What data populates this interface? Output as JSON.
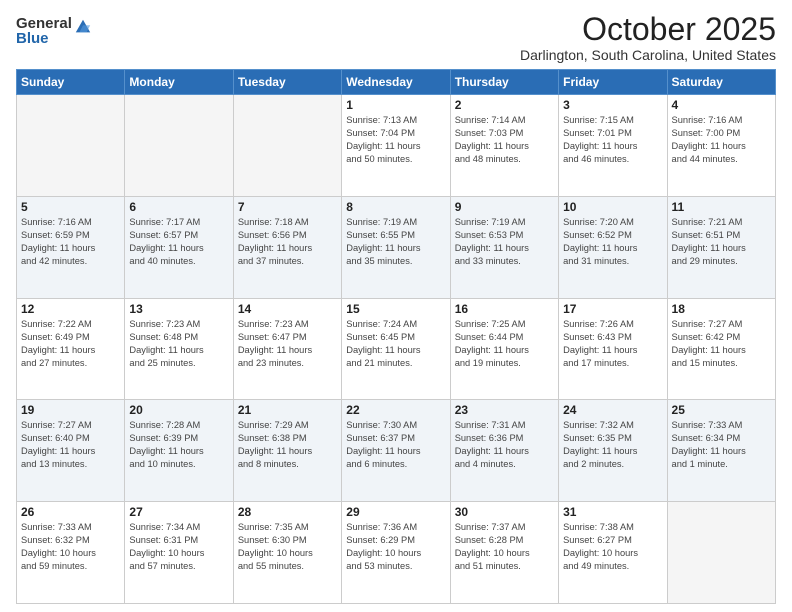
{
  "logo": {
    "general": "General",
    "blue": "Blue"
  },
  "header": {
    "month": "October 2025",
    "location": "Darlington, South Carolina, United States"
  },
  "days_of_week": [
    "Sunday",
    "Monday",
    "Tuesday",
    "Wednesday",
    "Thursday",
    "Friday",
    "Saturday"
  ],
  "weeks": [
    [
      {
        "day": "",
        "info": ""
      },
      {
        "day": "",
        "info": ""
      },
      {
        "day": "",
        "info": ""
      },
      {
        "day": "1",
        "info": "Sunrise: 7:13 AM\nSunset: 7:04 PM\nDaylight: 11 hours\nand 50 minutes."
      },
      {
        "day": "2",
        "info": "Sunrise: 7:14 AM\nSunset: 7:03 PM\nDaylight: 11 hours\nand 48 minutes."
      },
      {
        "day": "3",
        "info": "Sunrise: 7:15 AM\nSunset: 7:01 PM\nDaylight: 11 hours\nand 46 minutes."
      },
      {
        "day": "4",
        "info": "Sunrise: 7:16 AM\nSunset: 7:00 PM\nDaylight: 11 hours\nand 44 minutes."
      }
    ],
    [
      {
        "day": "5",
        "info": "Sunrise: 7:16 AM\nSunset: 6:59 PM\nDaylight: 11 hours\nand 42 minutes."
      },
      {
        "day": "6",
        "info": "Sunrise: 7:17 AM\nSunset: 6:57 PM\nDaylight: 11 hours\nand 40 minutes."
      },
      {
        "day": "7",
        "info": "Sunrise: 7:18 AM\nSunset: 6:56 PM\nDaylight: 11 hours\nand 37 minutes."
      },
      {
        "day": "8",
        "info": "Sunrise: 7:19 AM\nSunset: 6:55 PM\nDaylight: 11 hours\nand 35 minutes."
      },
      {
        "day": "9",
        "info": "Sunrise: 7:19 AM\nSunset: 6:53 PM\nDaylight: 11 hours\nand 33 minutes."
      },
      {
        "day": "10",
        "info": "Sunrise: 7:20 AM\nSunset: 6:52 PM\nDaylight: 11 hours\nand 31 minutes."
      },
      {
        "day": "11",
        "info": "Sunrise: 7:21 AM\nSunset: 6:51 PM\nDaylight: 11 hours\nand 29 minutes."
      }
    ],
    [
      {
        "day": "12",
        "info": "Sunrise: 7:22 AM\nSunset: 6:49 PM\nDaylight: 11 hours\nand 27 minutes."
      },
      {
        "day": "13",
        "info": "Sunrise: 7:23 AM\nSunset: 6:48 PM\nDaylight: 11 hours\nand 25 minutes."
      },
      {
        "day": "14",
        "info": "Sunrise: 7:23 AM\nSunset: 6:47 PM\nDaylight: 11 hours\nand 23 minutes."
      },
      {
        "day": "15",
        "info": "Sunrise: 7:24 AM\nSunset: 6:45 PM\nDaylight: 11 hours\nand 21 minutes."
      },
      {
        "day": "16",
        "info": "Sunrise: 7:25 AM\nSunset: 6:44 PM\nDaylight: 11 hours\nand 19 minutes."
      },
      {
        "day": "17",
        "info": "Sunrise: 7:26 AM\nSunset: 6:43 PM\nDaylight: 11 hours\nand 17 minutes."
      },
      {
        "day": "18",
        "info": "Sunrise: 7:27 AM\nSunset: 6:42 PM\nDaylight: 11 hours\nand 15 minutes."
      }
    ],
    [
      {
        "day": "19",
        "info": "Sunrise: 7:27 AM\nSunset: 6:40 PM\nDaylight: 11 hours\nand 13 minutes."
      },
      {
        "day": "20",
        "info": "Sunrise: 7:28 AM\nSunset: 6:39 PM\nDaylight: 11 hours\nand 10 minutes."
      },
      {
        "day": "21",
        "info": "Sunrise: 7:29 AM\nSunset: 6:38 PM\nDaylight: 11 hours\nand 8 minutes."
      },
      {
        "day": "22",
        "info": "Sunrise: 7:30 AM\nSunset: 6:37 PM\nDaylight: 11 hours\nand 6 minutes."
      },
      {
        "day": "23",
        "info": "Sunrise: 7:31 AM\nSunset: 6:36 PM\nDaylight: 11 hours\nand 4 minutes."
      },
      {
        "day": "24",
        "info": "Sunrise: 7:32 AM\nSunset: 6:35 PM\nDaylight: 11 hours\nand 2 minutes."
      },
      {
        "day": "25",
        "info": "Sunrise: 7:33 AM\nSunset: 6:34 PM\nDaylight: 11 hours\nand 1 minute."
      }
    ],
    [
      {
        "day": "26",
        "info": "Sunrise: 7:33 AM\nSunset: 6:32 PM\nDaylight: 10 hours\nand 59 minutes."
      },
      {
        "day": "27",
        "info": "Sunrise: 7:34 AM\nSunset: 6:31 PM\nDaylight: 10 hours\nand 57 minutes."
      },
      {
        "day": "28",
        "info": "Sunrise: 7:35 AM\nSunset: 6:30 PM\nDaylight: 10 hours\nand 55 minutes."
      },
      {
        "day": "29",
        "info": "Sunrise: 7:36 AM\nSunset: 6:29 PM\nDaylight: 10 hours\nand 53 minutes."
      },
      {
        "day": "30",
        "info": "Sunrise: 7:37 AM\nSunset: 6:28 PM\nDaylight: 10 hours\nand 51 minutes."
      },
      {
        "day": "31",
        "info": "Sunrise: 7:38 AM\nSunset: 6:27 PM\nDaylight: 10 hours\nand 49 minutes."
      },
      {
        "day": "",
        "info": ""
      }
    ]
  ]
}
